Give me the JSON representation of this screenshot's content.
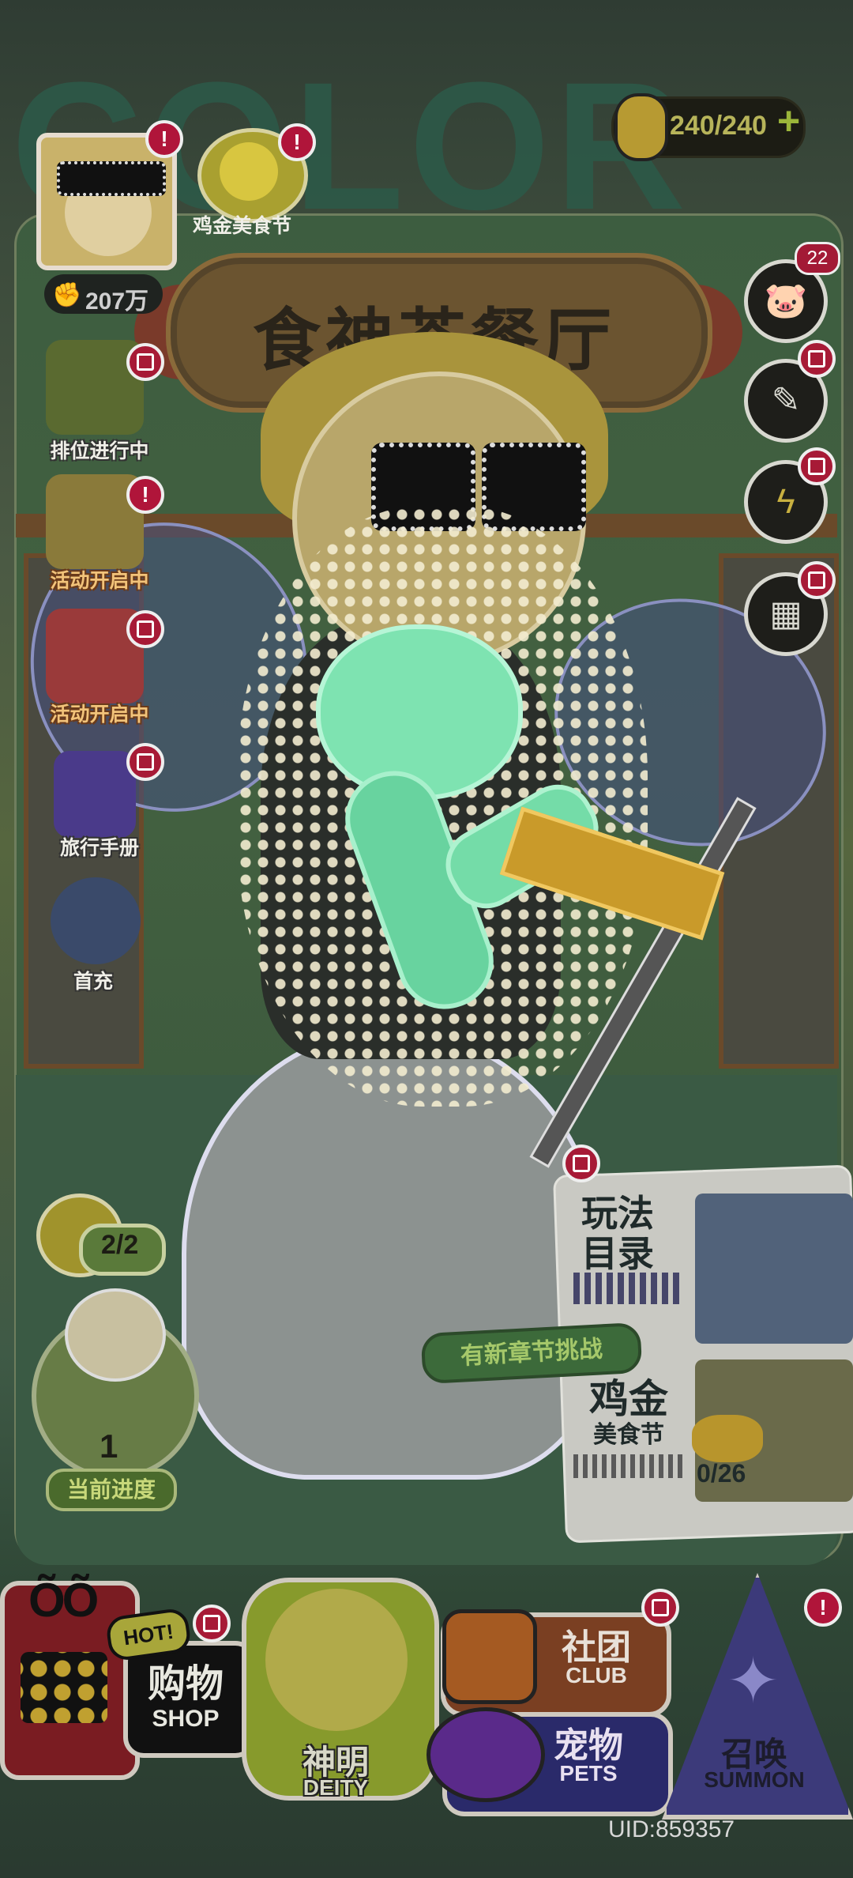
{
  "background": {
    "watermark": "COLOR",
    "sign_title": "食神茶餐厅"
  },
  "stamina": {
    "text": "240/240",
    "plus": "+"
  },
  "profile": {
    "power": "207万",
    "badge": "!"
  },
  "chick_event": {
    "label": "鸡金美食节",
    "badge": "!"
  },
  "left_events": [
    {
      "label": "排位进行中",
      "badge": "gift"
    },
    {
      "label": "活动开启中",
      "badge": "!"
    },
    {
      "label": "活动开启中",
      "badge": "gift"
    },
    {
      "label": "旅行手册",
      "badge": "gift"
    },
    {
      "label": "首充",
      "badge": "none"
    }
  ],
  "right_icons": [
    {
      "icon": "pig-mail-icon",
      "count": "22"
    },
    {
      "icon": "checklist-icon",
      "badge": "gift"
    },
    {
      "icon": "event-bolt-icon",
      "badge": "gift"
    },
    {
      "icon": "grid-menu-icon",
      "badge": "gift"
    }
  ],
  "playbook": {
    "title": "玩法目录"
  },
  "chick_fest": {
    "title": "鸡金",
    "subtitle": "美食节",
    "progress": "0/26",
    "new_chapter": "有新章节挑战"
  },
  "clock": {
    "count": "2/2"
  },
  "stage": {
    "number": "1",
    "label": "当前进度"
  },
  "nav": {
    "shop": {
      "cn": "购物",
      "en": "SHOP",
      "hot": "HOT!"
    },
    "deity": {
      "cn": "神明",
      "en": "DEITY"
    },
    "club": {
      "cn": "社团",
      "en": "CLUB"
    },
    "pets": {
      "cn": "宠物",
      "en": "PETS"
    },
    "summon": {
      "cn": "召唤",
      "en": "SUMMON"
    }
  },
  "uid": "UID:859357",
  "colors": {
    "accent_green": "#9bb63a",
    "badge_red": "#b0153a",
    "label_orange": "#f2c37a"
  }
}
